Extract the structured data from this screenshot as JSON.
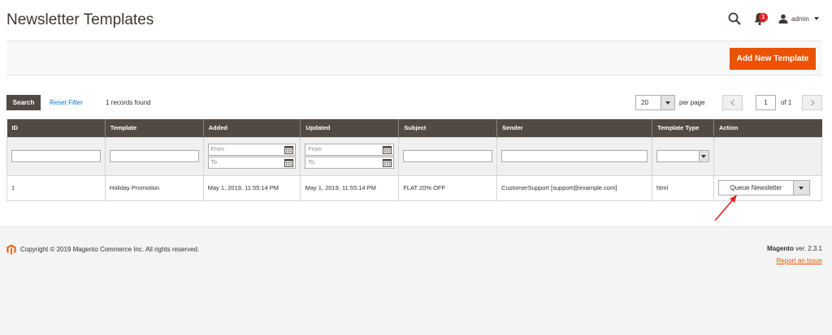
{
  "header": {
    "title": "Newsletter Templates",
    "notification_count": "1",
    "user_name": "admin"
  },
  "actions": {
    "add_new": "Add New Template"
  },
  "grid_controls": {
    "search": "Search",
    "reset_filter": "Reset Filter",
    "records_found": "1 records found",
    "per_page_value": "20",
    "per_page_label": "per page",
    "current_page": "1",
    "of_pages": "of 1"
  },
  "table": {
    "columns": [
      "ID",
      "Template",
      "Added",
      "Updated",
      "Subject",
      "Sender",
      "Template Type",
      "Action"
    ],
    "filters": {
      "from": "From",
      "to": "To"
    },
    "rows": [
      {
        "id": "1",
        "template": "Holiday Promotion",
        "added": "May 1, 2019, 11:55:14 PM",
        "updated": "May 1, 2019, 11:55:14 PM",
        "subject": "FLAT 20% OFF",
        "sender": "CustomerSupport [support@example.com]",
        "type": "html",
        "action": "Queue Newsletter"
      }
    ]
  },
  "footer": {
    "copyright": "Copyright © 2019 Magento Commerce Inc. All rights reserved.",
    "brand": "Magento",
    "version": " ver. 2.3.1",
    "report_issue": "Report an Issue"
  },
  "colors": {
    "accent": "#eb5202",
    "header_bg": "#514943",
    "link": "#007bdb",
    "annotation": "#e22626"
  }
}
